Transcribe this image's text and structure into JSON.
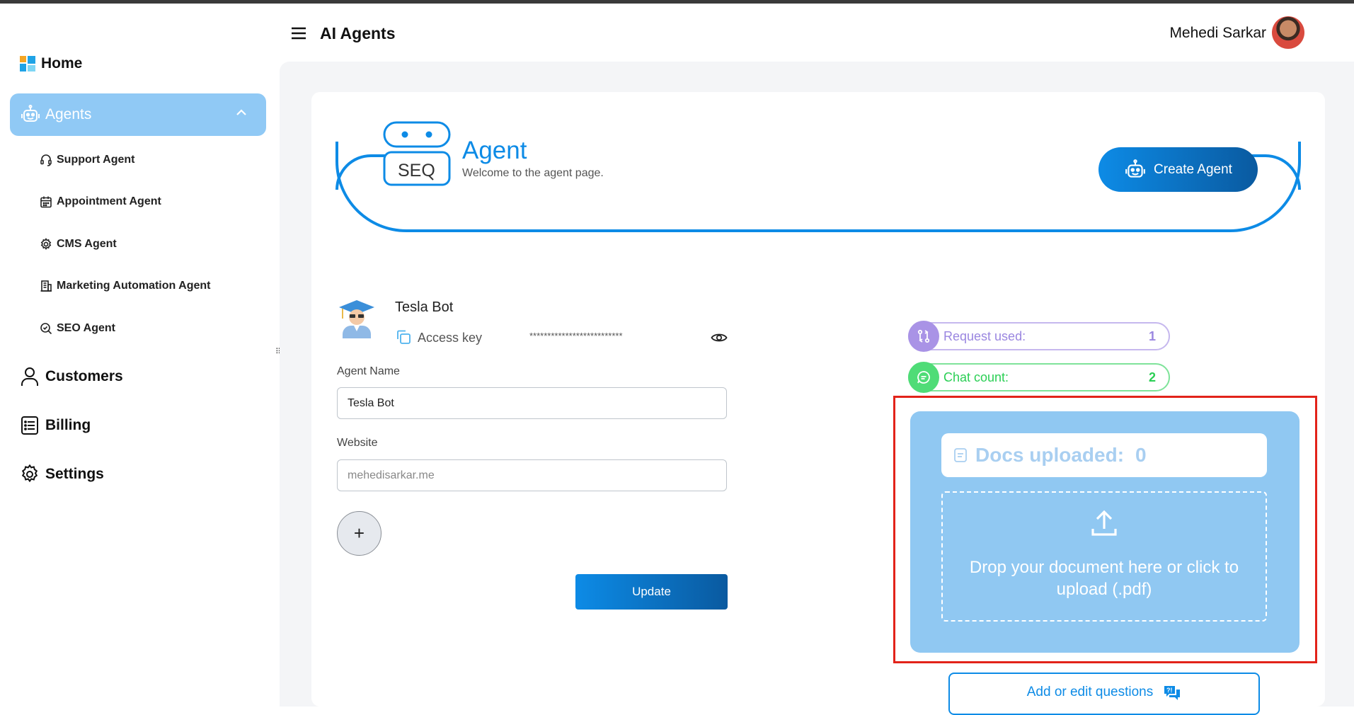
{
  "app": {
    "page_title": "AI Agents",
    "user_name": "Mehedi Sarkar"
  },
  "sidebar": {
    "home_label": "Home",
    "agents_label": "Agents",
    "sub_items": [
      {
        "label": "Support Agent",
        "icon": "headset-icon"
      },
      {
        "label": "Appointment Agent",
        "icon": "calendar-icon"
      },
      {
        "label": "CMS Agent",
        "icon": "gear-icon"
      },
      {
        "label": "Marketing Automation Agent",
        "icon": "building-icon"
      },
      {
        "label": "SEO Agent",
        "icon": "search-check-icon"
      }
    ],
    "items": [
      {
        "label": "Customers",
        "icon": "user-icon"
      },
      {
        "label": "Billing",
        "icon": "receipt-icon"
      },
      {
        "label": "Settings",
        "icon": "settings-icon"
      }
    ]
  },
  "hero": {
    "robot_text": "SEO",
    "title": "Agent",
    "subtitle": "Welcome to the agent page.",
    "create_button": "Create Agent"
  },
  "agent": {
    "name": "Tesla Bot",
    "access_key_label": "Access key",
    "access_key_masked": "**************************",
    "agent_name_label": "Agent Name",
    "agent_name_value": "Tesla Bot",
    "website_label": "Website",
    "website_placeholder": "mehedisarkar.me",
    "plus_symbol": "+",
    "update_button": "Update"
  },
  "stats": {
    "request_label": "Request used:",
    "request_value": "1",
    "chat_label": "Chat count:",
    "chat_value": "2"
  },
  "upload": {
    "docs_label": "Docs uploaded:",
    "docs_count": "0",
    "drop_text": "Drop your document here or click to upload (.pdf)"
  },
  "questions_button": "Add or edit questions",
  "colors": {
    "primary": "#0d8be6",
    "sidebar_active": "#90c9f5",
    "upload_bg": "#90c8f2",
    "highlight": "#e2231a"
  }
}
